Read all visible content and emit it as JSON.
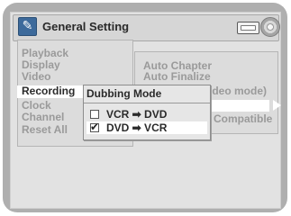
{
  "header": {
    "title": "General Setting",
    "icons": [
      "wrench-icon",
      "cassette-icon",
      "disc-icon"
    ]
  },
  "menu": {
    "items": [
      {
        "label": "Playback",
        "active": false
      },
      {
        "label": "Display",
        "active": false
      },
      {
        "label": "Video",
        "active": false
      },
      {
        "label": "Recording",
        "active": true
      },
      {
        "label": "Clock",
        "active": false
      },
      {
        "label": "Channel",
        "active": false
      },
      {
        "label": "Reset All",
        "active": false
      }
    ]
  },
  "submenu": {
    "items": [
      {
        "label": "Auto Chapter"
      },
      {
        "label": "Auto Finalize"
      },
      {
        "label": "ideo mode)"
      },
      {
        "label": "Compatible"
      }
    ]
  },
  "dialog": {
    "title": "Dubbing Mode",
    "options": [
      {
        "label": "VCR ➡ DVD",
        "checked": false,
        "selected": false
      },
      {
        "label": "DVD ➡ VCR",
        "checked": true,
        "selected": true
      }
    ]
  },
  "colors": {
    "frame": "#afafaf",
    "panel": "#dcdcdc",
    "highlight": "#ffffff",
    "wrench_icon_bg": "#3d6a9b"
  }
}
